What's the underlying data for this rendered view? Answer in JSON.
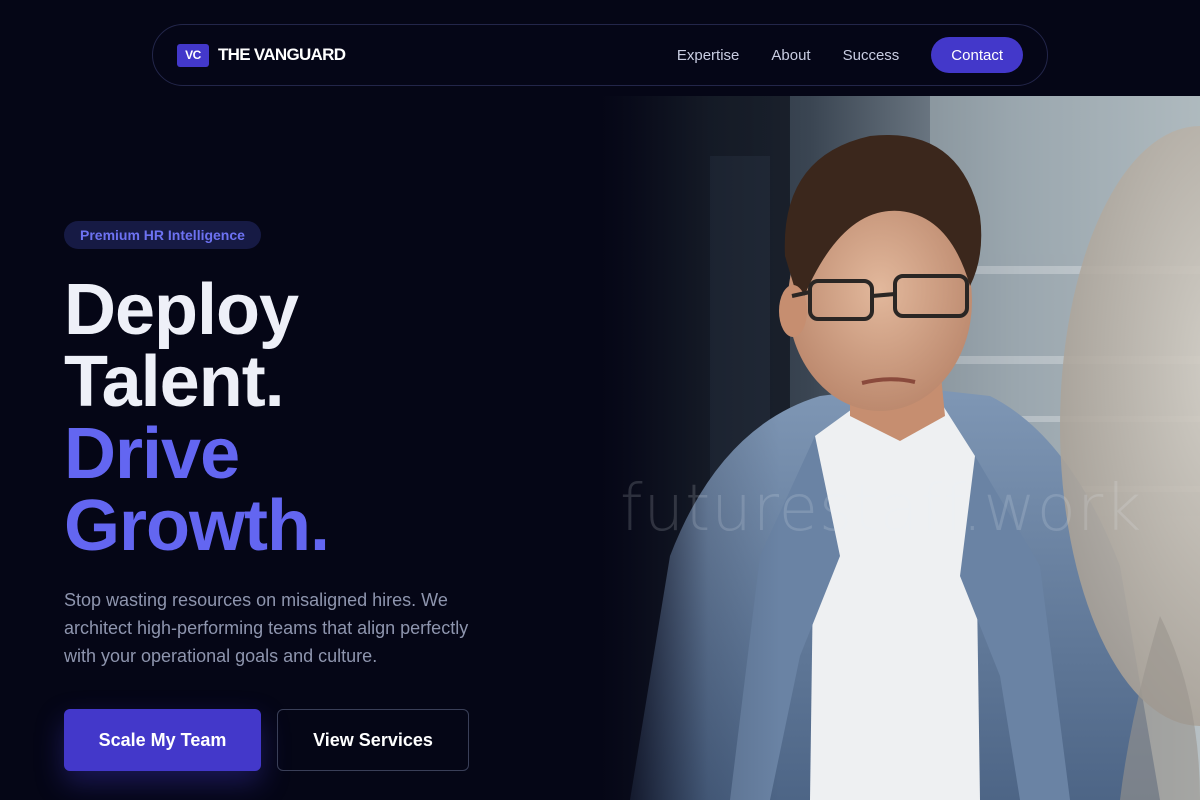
{
  "brand": {
    "logo_mark": "VC",
    "name": "THE VANGUARD",
    "accent_color": "#4338ca"
  },
  "nav": {
    "links": [
      {
        "label": "Expertise"
      },
      {
        "label": "About"
      },
      {
        "label": "Success"
      }
    ],
    "contact_label": "Contact"
  },
  "hero": {
    "badge": "Premium HR Intelligence",
    "headline_lines": [
      "Deploy",
      "Talent.",
      "Drive",
      "Growth."
    ],
    "headline_accent_color": "#6366f1",
    "description_lines": [
      "Stop wasting resources on misaligned hires. We",
      "architect high-performing teams that align perfectly",
      "with your operational goals and culture."
    ],
    "primary_cta": "Scale My Team",
    "secondary_cta": "View Services",
    "photo": {
      "subject": "young man with glasses in a light blue blazer and white shirt speaking in a meeting",
      "watermark": "futurestaff.work"
    }
  }
}
